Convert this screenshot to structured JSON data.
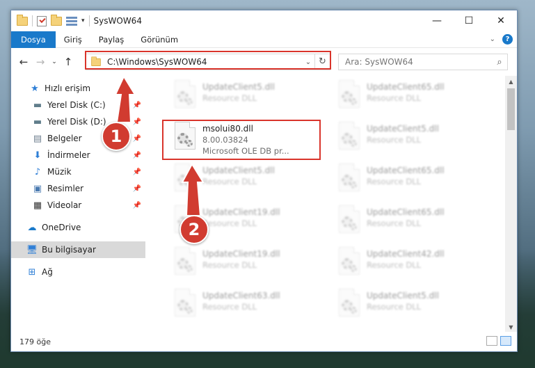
{
  "window": {
    "title": "SysWOW64"
  },
  "ribbon": {
    "tabs": [
      "Dosya",
      "Giriş",
      "Paylaş",
      "Görünüm"
    ],
    "help": "?"
  },
  "address": {
    "path": "C:\\Windows\\SysWOW64"
  },
  "search": {
    "placeholder": "Ara: SysWOW64"
  },
  "sidebar": {
    "items": [
      {
        "label": "Hızlı erişim",
        "icon": "star-icon"
      },
      {
        "label": "Yerel Disk (C:)",
        "icon": "drive-icon"
      },
      {
        "label": "Yerel Disk (D:)",
        "icon": "drive-icon"
      },
      {
        "label": "Belgeler",
        "icon": "documents-icon"
      },
      {
        "label": "İndirmeler",
        "icon": "download-icon"
      },
      {
        "label": "Müzik",
        "icon": "music-icon"
      },
      {
        "label": "Resimler",
        "icon": "pictures-icon"
      },
      {
        "label": "Videolar",
        "icon": "video-icon"
      },
      {
        "label": "OneDrive",
        "icon": "cloud-icon"
      },
      {
        "label": "Bu bilgisayar",
        "icon": "computer-icon"
      },
      {
        "label": "Ağ",
        "icon": "network-icon"
      }
    ]
  },
  "files": [
    {
      "name": "UpdateClient5.dll",
      "sub": "Resource DLL"
    },
    {
      "name": "UpdateClient65.dll",
      "sub": "Resource DLL"
    },
    {
      "name": "msolui80.dll",
      "version": "8.00.03824",
      "sub": "Microsoft OLE DB pr..."
    },
    {
      "name": "UpdateClient5.dll",
      "sub": "Resource DLL"
    },
    {
      "name": "UpdateClient5.dll",
      "sub": "Resource DLL"
    },
    {
      "name": "UpdateClient65.dll",
      "sub": "Resource DLL"
    },
    {
      "name": "UpdateClient19.dll",
      "sub": "Resource DLL"
    },
    {
      "name": "UpdateClient65.dll",
      "sub": "Resource DLL"
    },
    {
      "name": "UpdateClient19.dll",
      "sub": "Resource DLL"
    },
    {
      "name": "UpdateClient42.dll",
      "sub": "Resource DLL"
    },
    {
      "name": "UpdateClient63.dll",
      "sub": "Resource DLL"
    },
    {
      "name": "UpdateClient5.dll",
      "sub": "Resource DLL"
    }
  ],
  "status": {
    "count": "179 öğe"
  },
  "annotations": {
    "badge1": "1",
    "badge2": "2"
  },
  "colors": {
    "highlight": "#d9342b",
    "accent": "#1979ca"
  }
}
